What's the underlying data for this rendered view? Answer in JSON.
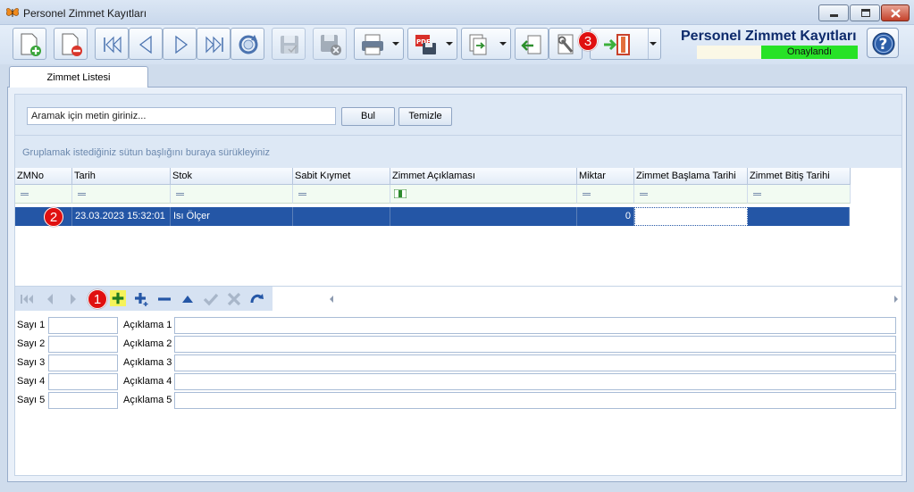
{
  "window": {
    "title": "Personel Zimmet Kayıtları"
  },
  "header": {
    "title": "Personel Zimmet Kayıtları",
    "status": "Onaylandı"
  },
  "tabs": [
    {
      "label": "Zimmet Listesi"
    }
  ],
  "search": {
    "placeholder": "Aramak için metin giriniz...",
    "value": "Aramak için metin giriniz...",
    "find_label": "Bul",
    "clear_label": "Temizle"
  },
  "group_hint": "Gruplamak istediğiniz sütun başlığını buraya sürükleyiniz",
  "grid": {
    "columns": [
      "ZMNo",
      "Tarih",
      "Stok",
      "Sabit Kıymet",
      "Zimmet Açıklaması",
      "Miktar",
      "Zimmet Başlama Tarihi",
      "Zimmet Bitiş Tarihi"
    ],
    "rows": [
      {
        "zmno": "",
        "tarih": "23.03.2023 15:32:01",
        "stok": "Isı Ölçer",
        "sabit_kiymet": "",
        "aciklama": "",
        "miktar": "0",
        "baslama": "",
        "bitis": ""
      }
    ]
  },
  "badges": [
    "1",
    "2",
    "3"
  ],
  "form": {
    "sayi_labels": [
      "Sayı 1",
      "Sayı 2",
      "Sayı 3",
      "Sayı 4",
      "Sayı 5"
    ],
    "aciklama_labels": [
      "Açıklama 1",
      "Açıklama 2",
      "Açıklama 3",
      "Açıklama 4",
      "Açıklama 5"
    ]
  },
  "colors": {
    "accent": "#2456a6",
    "status_ok": "#27e227",
    "badge": "#e01010"
  }
}
